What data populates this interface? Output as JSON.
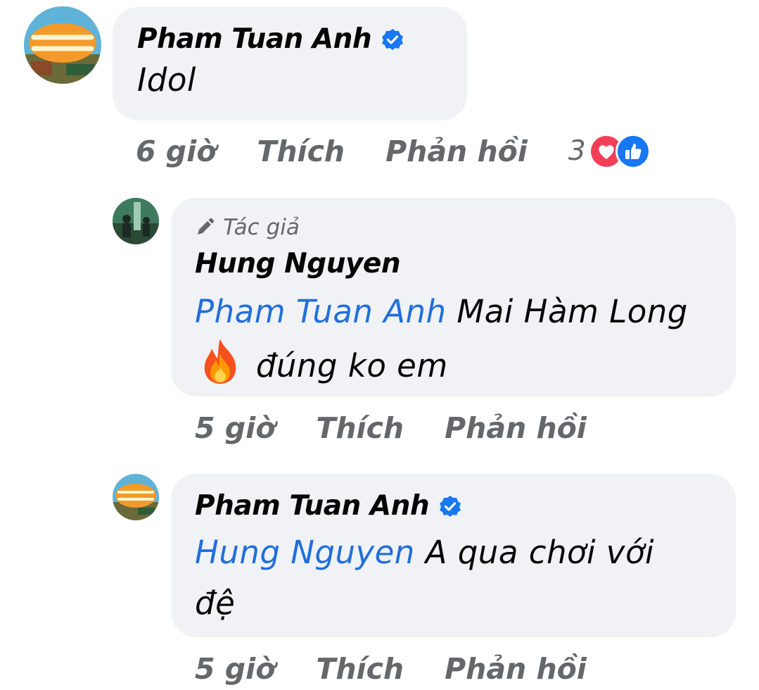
{
  "comments": [
    {
      "author": "Pham Tuan Anh",
      "verified": true,
      "text": "Idol",
      "time": "6 giờ",
      "like_label": "Thích",
      "reply_label": "Phản hồi",
      "reaction_count": "3",
      "reactions": [
        "love-icon",
        "like-icon"
      ]
    }
  ],
  "replies": [
    {
      "badge": "Tác giả",
      "author": "Hung Nguyen",
      "mention": "Pham Tuan Anh",
      "text_part1": "Mai Hàm Long",
      "emoji": "fire-emoji",
      "text_part2": "đúng ko em",
      "time": "5 giờ",
      "like_label": "Thích",
      "reply_label": "Phản hồi"
    },
    {
      "author": "Pham Tuan Anh",
      "verified": true,
      "mention": "Hung Nguyen",
      "text": "A qua chơi với đệ",
      "time": "5 giờ",
      "like_label": "Thích",
      "reply_label": "Phản hồi"
    }
  ],
  "colors": {
    "bubble": "#f0f2f5",
    "mention": "#216fdb",
    "meta": "#65676b",
    "verified": "#1877f2",
    "love": "#f33e58",
    "like": "#1877f2"
  }
}
